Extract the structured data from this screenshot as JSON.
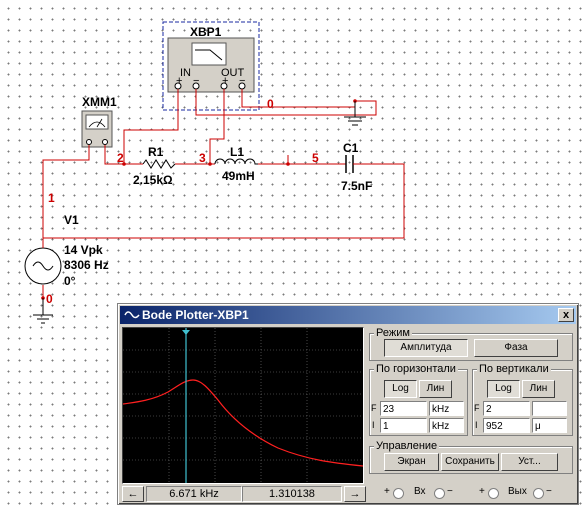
{
  "schematic": {
    "bode_instrument": {
      "name": "XBP1",
      "in_label": "IN",
      "out_label": "OUT"
    },
    "multimeter": {
      "name": "XMM1"
    },
    "r1": {
      "name": "R1",
      "value": "2.15kΩ"
    },
    "l1": {
      "name": "L1",
      "value": "49mH"
    },
    "c1": {
      "name": "C1",
      "value": "7.5nF"
    },
    "v1": {
      "name": "V1",
      "amplitude": "14 Vpk",
      "frequency": "8306 Hz",
      "phase": "0°"
    },
    "nodes": [
      "0",
      "1",
      "2",
      "3",
      "5",
      "0"
    ],
    "wire_color": "#cc0000"
  },
  "bode": {
    "title": "Bode Plotter-XBP1",
    "close_label": "x",
    "mode": {
      "title": "Режим",
      "amplitude_label": "Амплитуда",
      "phase_label": "Фаза"
    },
    "horizontal": {
      "title": "По горизонтали",
      "log_label": "Log",
      "lin_label": "Лин",
      "f_label": "F",
      "i_label": "I",
      "f_value": "23",
      "f_unit": "kHz",
      "i_value": "1",
      "i_unit": "kHz"
    },
    "vertical": {
      "title": "По вертикали",
      "log_label": "Log",
      "lin_label": "Лин",
      "f_label": "F",
      "i_label": "I",
      "f_value": "2",
      "f_unit": "",
      "i_value": "952",
      "i_unit": "μ"
    },
    "controls": {
      "title": "Управление",
      "screen_label": "Экран",
      "save_label": "Сохранить",
      "setup_label": "Уст..."
    },
    "readout": {
      "frequency": "6.671 kHz",
      "magnitude": "1.310138",
      "left_arrow": "←",
      "right_arrow": "→"
    },
    "terminals": {
      "in_label": "Вх",
      "out_label": "Вых",
      "plus": "+",
      "minus": "−"
    },
    "curve_color": "#ff2020",
    "cursor_color": "#40c0d0"
  }
}
